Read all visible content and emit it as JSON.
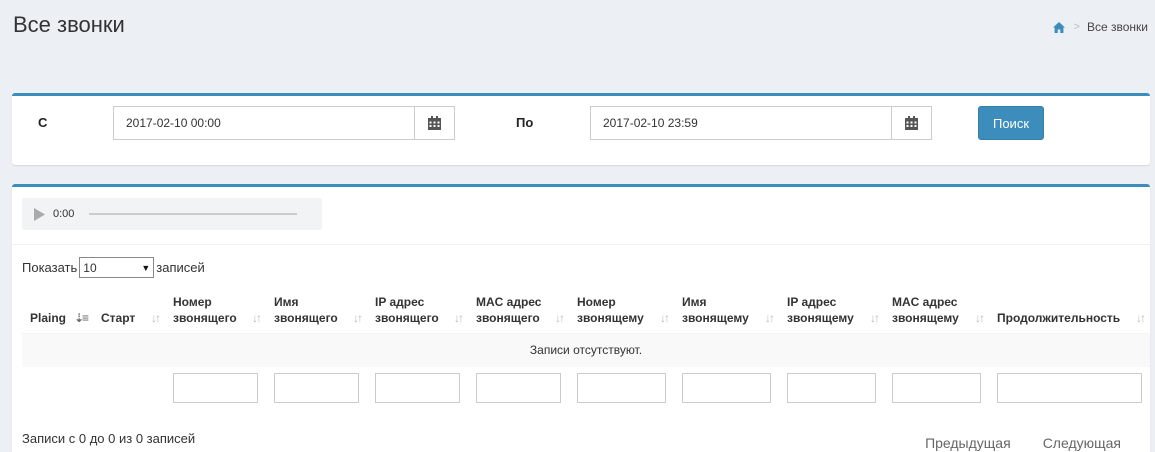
{
  "page": {
    "title": "Все звонки"
  },
  "breadcrumb": {
    "current": "Все звонки"
  },
  "filter": {
    "from_label": "С",
    "from_value": "2017-02-10 00:00",
    "to_label": "По",
    "to_value": "2017-02-10 23:59",
    "search_label": "Поиск"
  },
  "player": {
    "time": "0:00"
  },
  "length": {
    "prefix": "Показать",
    "value": "10",
    "suffix": "записей"
  },
  "table": {
    "columns": [
      {
        "l1": "Plaing",
        "l2": ""
      },
      {
        "l1": "Старт",
        "l2": ""
      },
      {
        "l1": "Номер",
        "l2": "звонящего"
      },
      {
        "l1": "Имя",
        "l2": "звонящего"
      },
      {
        "l1": "IP адрес",
        "l2": "звонящего"
      },
      {
        "l1": "MAC адрес",
        "l2": "звонящего"
      },
      {
        "l1": "Номер",
        "l2": "звонящему"
      },
      {
        "l1": "Имя",
        "l2": "звонящему"
      },
      {
        "l1": "IP адрес",
        "l2": "звонящему"
      },
      {
        "l1": "MAC адрес",
        "l2": "звонящему"
      },
      {
        "l1": "Продолжительность",
        "l2": ""
      }
    ],
    "empty_text": "Записи отсутствуют."
  },
  "info": "Записи с 0 до 0 из 0 записей",
  "pagination": {
    "prev": "Предыдущая",
    "next": "Следующая"
  },
  "colors": {
    "accent": "#3c8dbc",
    "background": "#ecf0f5"
  }
}
